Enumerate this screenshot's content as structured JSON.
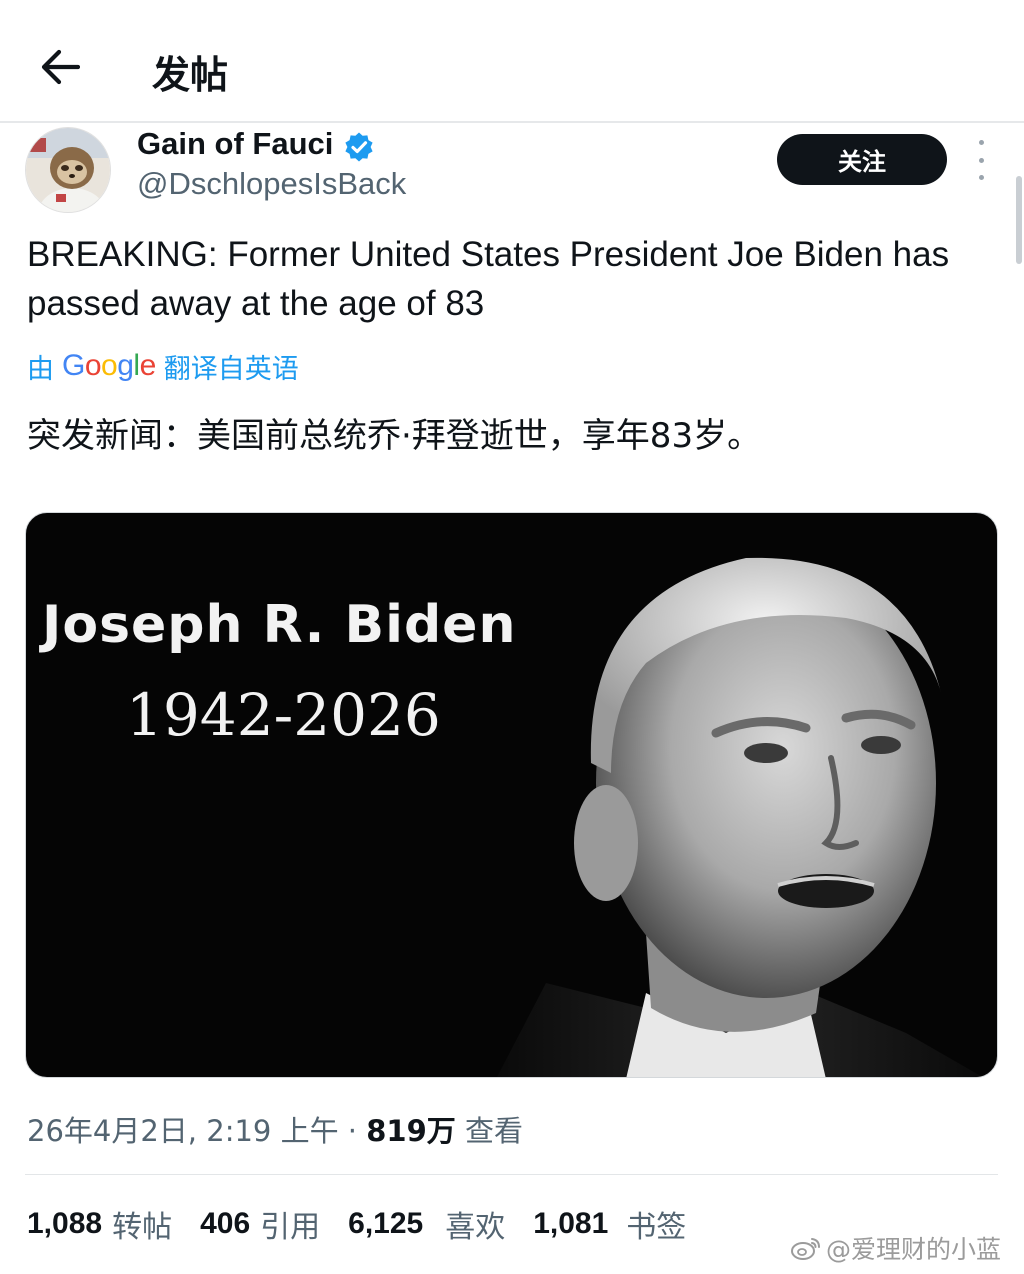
{
  "header": {
    "title": "发帖",
    "back_icon": "arrow-left-icon"
  },
  "author": {
    "display_name": "Gain of Fauci",
    "handle": "@DschlopesIsBack",
    "verified": true,
    "verified_color": "#1d9bf0",
    "avatar_icon": "sloth-astronaut-avatar"
  },
  "follow_button": {
    "label": "关注"
  },
  "more_icon": "more-vertical-icon",
  "post": {
    "text": "BREAKING: Former United States President Joe Biden has passed away at the age of 83",
    "translation_prefix": "由",
    "translation_brand": "Google",
    "translation_suffix": "翻译自英语",
    "translated_text": "突发新闻：美国前总统乔·拜登逝世，享年83岁。"
  },
  "media": {
    "name": "Joseph R. Biden",
    "years": "1942-2026"
  },
  "meta": {
    "timestamp": "26年4月2日, 2:19 上午 ·",
    "views_count": "819万",
    "views_label": "查看"
  },
  "stats": [
    {
      "count": "1,088",
      "label": "转帖"
    },
    {
      "count": "406",
      "label": "引用"
    },
    {
      "count": "6,125",
      "label": "喜欢"
    },
    {
      "count": "1,081",
      "label": "书签"
    }
  ],
  "watermark": {
    "icon": "weibo-icon",
    "text": "@爱理财的小蓝"
  },
  "colors": {
    "accent": "#1d9bf0",
    "text_primary": "#0f1419",
    "text_secondary": "#536471",
    "follow_bg": "#0f1419"
  }
}
